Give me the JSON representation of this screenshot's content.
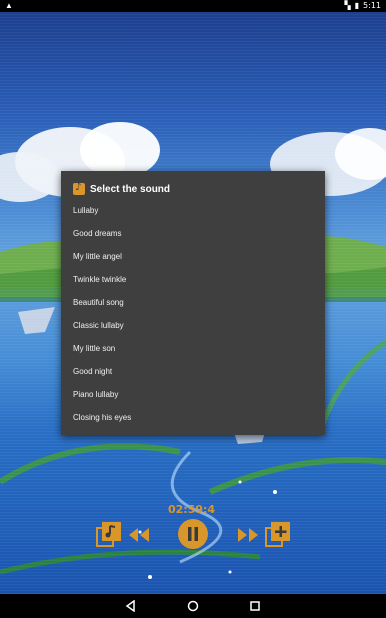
{
  "status": {
    "time": "5:11"
  },
  "dialog": {
    "title": "Select the sound",
    "items": [
      "Lullaby",
      "Good dreams",
      "My little angel",
      "Twinkle twinkle",
      "Beautiful song",
      "Classic lullaby",
      "My little son",
      "Good night",
      "Piano lullaby",
      "Closing his eyes"
    ]
  },
  "player": {
    "timer": "02:59:4",
    "accent_color": "#d9962b"
  },
  "icons": {
    "playlist": "music-library-icon",
    "rewind": "rewind-icon",
    "pause": "pause-icon",
    "forward": "fast-forward-icon",
    "add": "add-playlist-icon"
  }
}
